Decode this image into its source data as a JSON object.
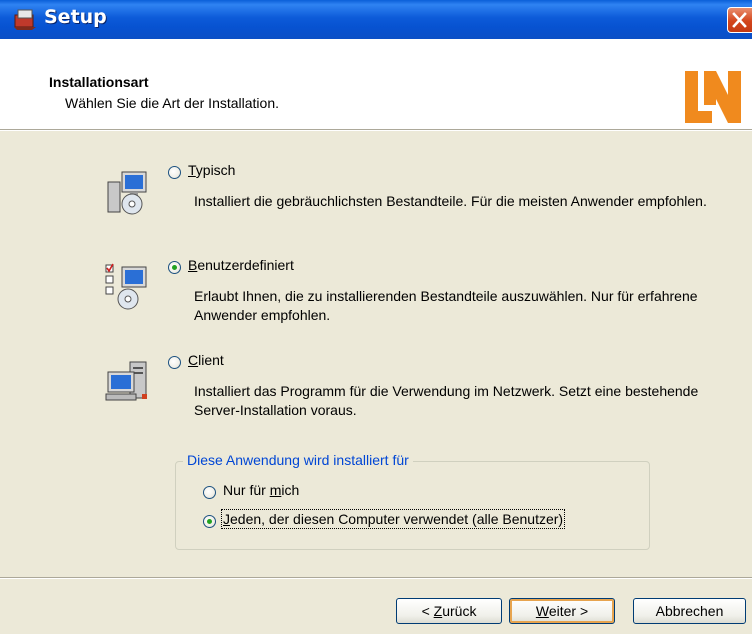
{
  "window": {
    "title": "Setup",
    "close_label": "✕"
  },
  "header": {
    "title": "Installationsart",
    "subtitle": "Wählen Sie die Art der Installation.",
    "logo_text": "LN"
  },
  "options": [
    {
      "label": "Typisch",
      "mnemonic": "T",
      "rest": "ypisch",
      "selected": false,
      "description": "Installiert die gebräuchlichsten Bestandteile. Für die meisten Anwender empfohlen."
    },
    {
      "label": "Benutzerdefiniert",
      "mnemonic": "B",
      "rest": "enutzerdefiniert",
      "selected": true,
      "description": "Erlaubt Ihnen, die zu installierenden Bestandteile auszuwählen. Nur für erfahrene Anwender empfohlen."
    },
    {
      "label": "Client",
      "mnemonic": "C",
      "rest": "lient",
      "selected": false,
      "description": "Installiert das Programm für die Verwendung im Netzwerk. Setzt eine bestehende Server-Installation voraus."
    }
  ],
  "install_for": {
    "group_title": "Diese Anwendung wird installiert für",
    "options": [
      {
        "pre": "Nur für ",
        "mnemonic": "m",
        "post": "ich",
        "selected": false
      },
      {
        "pre": "",
        "mnemonic": "J",
        "post": "eden, der diesen Computer verwendet (alle Benutzer)",
        "selected": true
      }
    ]
  },
  "buttons": {
    "back": {
      "prefix": "< ",
      "mnemonic": "Z",
      "rest": "urück"
    },
    "next": {
      "mnemonic": "W",
      "rest": "eiter >"
    },
    "cancel": {
      "label": "Abbrechen"
    }
  },
  "colors": {
    "titlebar": "#0a5fd8",
    "group_title": "#0046d5",
    "logo": "#f08a1e",
    "radio_dot": "#21a121"
  }
}
